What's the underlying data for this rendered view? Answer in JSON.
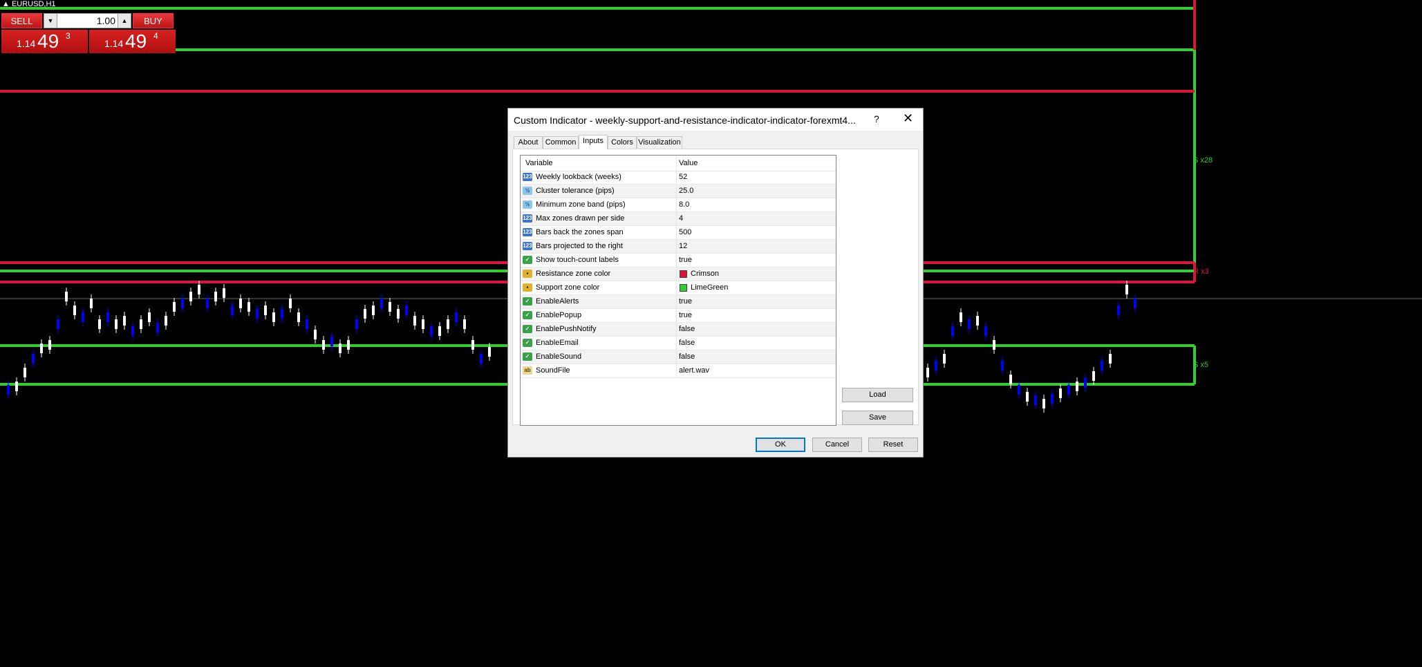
{
  "window": {
    "symbol_title": "EURUSD,H1"
  },
  "trade_panel": {
    "sell_label": "SELL",
    "buy_label": "BUY",
    "lot_value": "1.00",
    "bid": {
      "small": "1.14",
      "big": "49",
      "sup": "3"
    },
    "ask": {
      "small": "1.14",
      "big": "49",
      "sup": "4"
    }
  },
  "chart": {
    "labels": {
      "upper_support": "S x28",
      "resistance": "R x3",
      "lower_support": "S x5"
    },
    "colors": {
      "resistance": "#DC143C",
      "support": "#32CD32",
      "bull_candle": "#ffffff",
      "bear_candle": "#0000ff"
    }
  },
  "dialog": {
    "title": "Custom Indicator - weekly-support-and-resistance-indicator-indicator-forexmt4...",
    "help_label": "?",
    "close_label": "✕",
    "tabs": [
      {
        "label": "About"
      },
      {
        "label": "Common"
      },
      {
        "label": "Inputs",
        "active": true
      },
      {
        "label": "Colors"
      },
      {
        "label": "Visualization"
      }
    ],
    "grid": {
      "headers": {
        "variable": "Variable",
        "value": "Value"
      },
      "rows": [
        {
          "icon": "123",
          "icon_type": "int-param-icon",
          "name": "Weekly lookback (weeks)",
          "value": "52"
        },
        {
          "icon": "½",
          "icon_type": "double-param-icon",
          "name": "Cluster tolerance (pips)",
          "value": "25.0"
        },
        {
          "icon": "½",
          "icon_type": "double-param-icon",
          "name": "Minimum zone band (pips)",
          "value": "8.0"
        },
        {
          "icon": "123",
          "icon_type": "int-param-icon",
          "name": "Max zones drawn per side",
          "value": "4"
        },
        {
          "icon": "123",
          "icon_type": "int-param-icon",
          "name": "Bars back the zones span",
          "value": "500"
        },
        {
          "icon": "123",
          "icon_type": "int-param-icon",
          "name": "Bars projected to the right",
          "value": "12"
        },
        {
          "icon": "✓",
          "icon_type": "bool-param-icon",
          "name": "Show touch-count labels",
          "value": "true"
        },
        {
          "icon": "▪",
          "icon_type": "color-param-icon",
          "name": "Resistance zone color",
          "value": "Crimson",
          "swatch": "#DC143C"
        },
        {
          "icon": "▪",
          "icon_type": "color-param-icon",
          "name": "Support zone color",
          "value": "LimeGreen",
          "swatch": "#32CD32"
        },
        {
          "icon": "✓",
          "icon_type": "bool-param-icon",
          "name": "EnableAlerts",
          "value": "true"
        },
        {
          "icon": "✓",
          "icon_type": "bool-param-icon",
          "name": "EnablePopup",
          "value": "true"
        },
        {
          "icon": "✓",
          "icon_type": "bool-param-icon",
          "name": "EnablePushNotify",
          "value": "false"
        },
        {
          "icon": "✓",
          "icon_type": "bool-param-icon",
          "name": "EnableEmail",
          "value": "false"
        },
        {
          "icon": "✓",
          "icon_type": "bool-param-icon",
          "name": "EnableSound",
          "value": "false"
        },
        {
          "icon": "ab",
          "icon_type": "string-param-icon",
          "name": "SoundFile",
          "value": "alert.wav"
        }
      ]
    },
    "buttons": {
      "load": "Load",
      "save": "Save",
      "ok": "OK",
      "cancel": "Cancel",
      "reset": "Reset"
    }
  }
}
